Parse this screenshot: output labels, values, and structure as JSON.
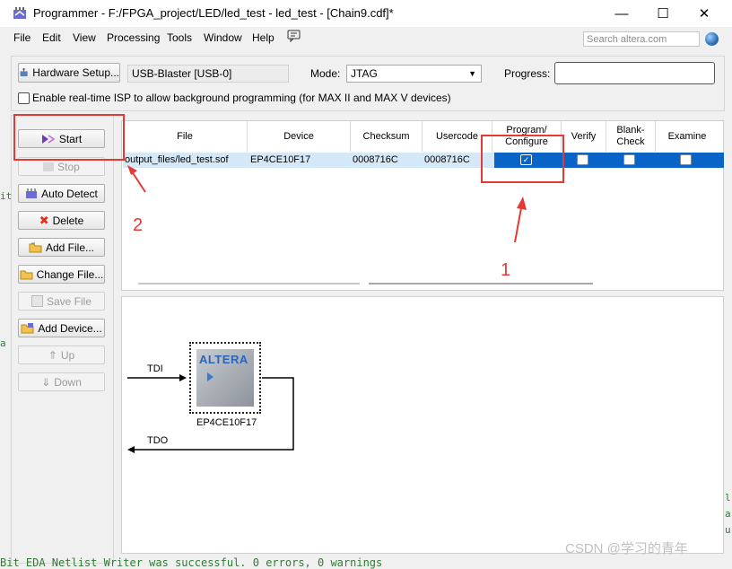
{
  "window": {
    "title": "Programmer - F:/FPGA_project/LED/led_test - led_test - [Chain9.cdf]*",
    "minimize": "—",
    "maximize": "☐",
    "close": "✕"
  },
  "menu": [
    "File",
    "Edit",
    "View",
    "Processing",
    "Tools",
    "Window",
    "Help"
  ],
  "search": {
    "placeholder": "Search altera.com"
  },
  "toolbar": {
    "hardware_setup_label": "Hardware Setup...",
    "hardware_value": "USB-Blaster [USB-0]",
    "mode_label": "Mode:",
    "mode_value": "JTAG",
    "progress_label": "Progress:",
    "isp_label": "Enable real-time ISP to allow background programming (for MAX II and MAX V devices)"
  },
  "side_buttons": {
    "start": "Start",
    "stop": "Stop",
    "auto_detect": "Auto Detect",
    "delete": "Delete",
    "add_file": "Add File...",
    "change_file": "Change File...",
    "save_file": "Save File",
    "add_device": "Add Device...",
    "up": "Up",
    "down": "Down"
  },
  "table": {
    "headers": {
      "file": "File",
      "device": "Device",
      "checksum": "Checksum",
      "usercode": "Usercode",
      "program": "Program/ Configure",
      "verify": "Verify",
      "blank": "Blank- Check",
      "examine": "Examine"
    },
    "row": {
      "file": "output_files/led_test.sof",
      "device": "EP4CE10F17",
      "checksum": "0008716C",
      "usercode": "0008716C",
      "program": true,
      "verify": false,
      "blank": false,
      "examine": false
    }
  },
  "diagram": {
    "tdi": "TDI",
    "tdo": "TDO",
    "chip_brand": "ALTERA",
    "chip_name": "EP4CE10F17"
  },
  "annotations": {
    "num1": "1",
    "num2": "2"
  },
  "console": {
    "text": "Bit EDA Netlist Writer was successful. 0 errors, 0 warnings"
  },
  "watermark": "CSDN @学习的青年",
  "colors": {
    "selection": "#0a64c8",
    "annotation": "#e53935",
    "row_highlight": "#d5e8f8"
  }
}
